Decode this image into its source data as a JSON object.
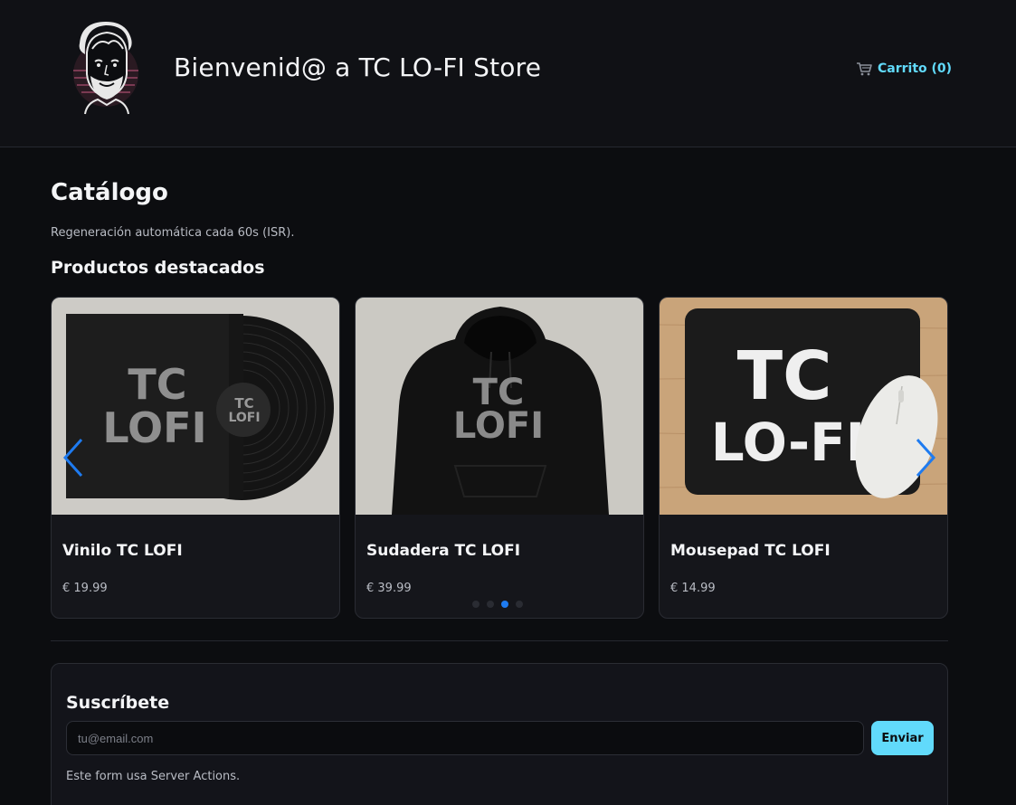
{
  "header": {
    "title": "Bienvenid@ a TC LO-FI Store",
    "cart_label": "Carrito (0)"
  },
  "catalog": {
    "title": "Catálogo",
    "isr_note": "Regeneración automática cada 60s (ISR).",
    "featured_title": "Productos destacados"
  },
  "products": [
    {
      "name": "Vinilo TC LOFI",
      "price": "€ 19.99",
      "image_text": [
        "TC",
        "LOFI"
      ],
      "label_text": [
        "TC",
        "LOFI"
      ]
    },
    {
      "name": "Sudadera TC LOFI",
      "price": "€ 39.99",
      "image_text": [
        "TC",
        "LOFI"
      ]
    },
    {
      "name": "Mousepad TC LOFI",
      "price": "€ 14.99",
      "image_text": [
        "TC",
        "LO-FI"
      ]
    }
  ],
  "carousel": {
    "dot_count": 4,
    "active_dot": 2,
    "prev_icon": "chevron-left-icon",
    "next_icon": "chevron-right-icon"
  },
  "subscribe": {
    "title": "Suscríbete",
    "email_placeholder": "tu@email.com",
    "button_label": "Enviar",
    "note": "Este form usa Server Actions."
  },
  "colors": {
    "accent": "#61dafb",
    "arrow": "#1e7bf0",
    "background": "#0c0d10"
  }
}
